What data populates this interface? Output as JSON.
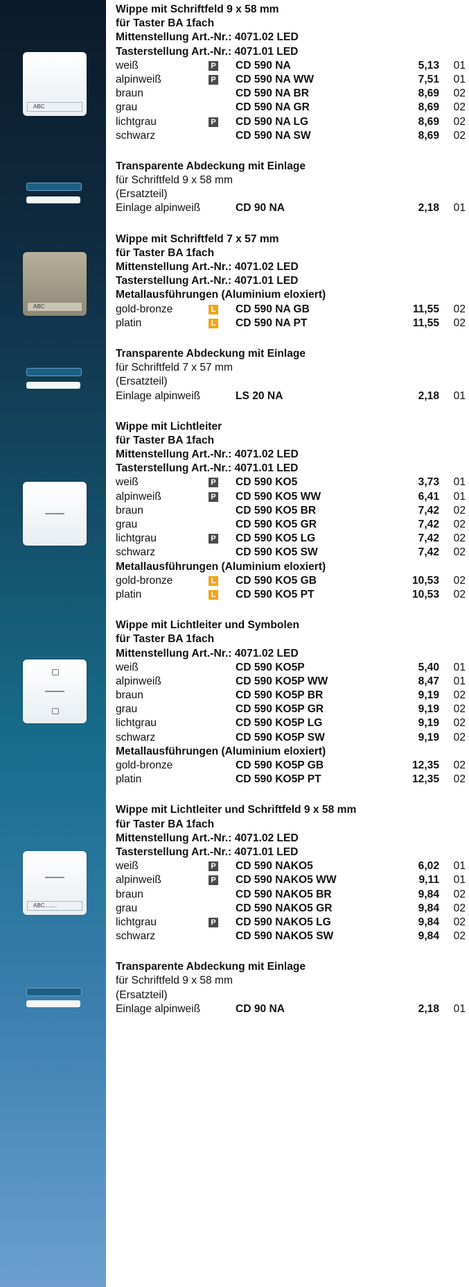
{
  "sections": [
    {
      "heading": [
        "Wippe mit Schriftfeld 9 x 58 mm",
        "für Taster BA 1fach",
        "Mittenstellung Art.-Nr.: 4071.02 LED",
        "Tasterstellung Art.-Nr.: 4071.01 LED"
      ],
      "rows": [
        {
          "color": "weiß",
          "badge": "P",
          "code": "CD 590 NA",
          "price": "5,13",
          "grp": "01"
        },
        {
          "color": "alpinweiß",
          "badge": "P",
          "code": "CD 590 NA WW",
          "price": "7,51",
          "grp": "01"
        },
        {
          "color": "braun",
          "badge": "",
          "code": "CD 590 NA BR",
          "price": "8,69",
          "grp": "02"
        },
        {
          "color": "grau",
          "badge": "",
          "code": "CD 590 NA GR",
          "price": "8,69",
          "grp": "02"
        },
        {
          "color": "lichtgrau",
          "badge": "P",
          "code": "CD 590 NA LG",
          "price": "8,69",
          "grp": "02"
        },
        {
          "color": "schwarz",
          "badge": "",
          "code": "CD 590 NA SW",
          "price": "8,69",
          "grp": "02"
        }
      ]
    },
    {
      "heading": [
        "Transparente Abdeckung mit Einlage"
      ],
      "text": [
        "für Schriftfeld 9 x 58 mm",
        "(Ersatzteil)"
      ],
      "rows": [
        {
          "color": "Einlage alpinweiß",
          "badge": "",
          "code": "CD 90 NA",
          "price": "2,18",
          "grp": "01"
        }
      ]
    },
    {
      "heading": [
        "Wippe mit Schriftfeld 7 x 57 mm",
        "für Taster BA 1fach",
        "Mittenstellung Art.-Nr.: 4071.02 LED",
        "Tasterstellung Art.-Nr.: 4071.01 LED",
        "Metallausführungen (Aluminium eloxiert)"
      ],
      "rows": [
        {
          "color": "gold-bronze",
          "badge": "L",
          "code": "CD 590 NA GB",
          "price": "11,55",
          "grp": "02"
        },
        {
          "color": "platin",
          "badge": "L",
          "code": "CD 590 NA PT",
          "price": "11,55",
          "grp": "02"
        }
      ]
    },
    {
      "heading": [
        "Transparente Abdeckung mit Einlage"
      ],
      "text": [
        "für Schriftfeld 7 x 57 mm",
        "(Ersatzteil)"
      ],
      "rows": [
        {
          "color": "Einlage alpinweiß",
          "badge": "",
          "code": "LS 20 NA",
          "price": "2,18",
          "grp": "01"
        }
      ]
    },
    {
      "heading": [
        "Wippe mit Lichtleiter",
        "für Taster BA 1fach",
        "Mittenstellung Art.-Nr.: 4071.02 LED",
        "Tasterstellung Art.-Nr.: 4071.01 LED"
      ],
      "rows": [
        {
          "color": "weiß",
          "badge": "P",
          "code": "CD 590 KO5",
          "price": "3,73",
          "grp": "01"
        },
        {
          "color": "alpinweiß",
          "badge": "P",
          "code": "CD 590 KO5 WW",
          "price": "6,41",
          "grp": "01"
        },
        {
          "color": "braun",
          "badge": "",
          "code": "CD 590 KO5 BR",
          "price": "7,42",
          "grp": "02"
        },
        {
          "color": "grau",
          "badge": "",
          "code": "CD 590 KO5 GR",
          "price": "7,42",
          "grp": "02"
        },
        {
          "color": "lichtgrau",
          "badge": "P",
          "code": "CD 590 KO5 LG",
          "price": "7,42",
          "grp": "02"
        },
        {
          "color": "schwarz",
          "badge": "",
          "code": "CD 590 KO5 SW",
          "price": "7,42",
          "grp": "02"
        }
      ],
      "subheading": "Metallausführungen (Aluminium eloxiert)",
      "rows2": [
        {
          "color": "gold-bronze",
          "badge": "L",
          "code": "CD 590 KO5 GB",
          "price": "10,53",
          "grp": "02"
        },
        {
          "color": "platin",
          "badge": "L",
          "code": "CD 590 KO5 PT",
          "price": "10,53",
          "grp": "02"
        }
      ]
    },
    {
      "heading": [
        "Wippe mit Lichtleiter und Symbolen",
        "für Taster BA 1fach",
        "Mittenstellung Art.-Nr.: 4071.02 LED"
      ],
      "rows": [
        {
          "color": "weiß",
          "badge": "",
          "code": "CD 590 KO5P",
          "price": "5,40",
          "grp": "01"
        },
        {
          "color": "alpinweiß",
          "badge": "",
          "code": "CD 590 KO5P WW",
          "price": "8,47",
          "grp": "01"
        },
        {
          "color": "braun",
          "badge": "",
          "code": "CD 590 KO5P BR",
          "price": "9,19",
          "grp": "02"
        },
        {
          "color": "grau",
          "badge": "",
          "code": "CD 590 KO5P GR",
          "price": "9,19",
          "grp": "02"
        },
        {
          "color": "lichtgrau",
          "badge": "",
          "code": "CD 590 KO5P LG",
          "price": "9,19",
          "grp": "02"
        },
        {
          "color": "schwarz",
          "badge": "",
          "code": "CD 590 KO5P SW",
          "price": "9,19",
          "grp": "02"
        }
      ],
      "subheading": "Metallausführungen (Aluminium eloxiert)",
      "rows2": [
        {
          "color": "gold-bronze",
          "badge": "",
          "code": "CD 590 KO5P GB",
          "price": "12,35",
          "grp": "02"
        },
        {
          "color": "platin",
          "badge": "",
          "code": "CD 590 KO5P PT",
          "price": "12,35",
          "grp": "02"
        }
      ]
    },
    {
      "heading": [
        "Wippe mit Lichtleiter und Schriftfeld 9 x 58 mm",
        "für Taster BA 1fach",
        "Mittenstellung Art.-Nr.: 4071.02 LED",
        "Tasterstellung Art.-Nr.: 4071.01 LED"
      ],
      "rows": [
        {
          "color": "weiß",
          "badge": "P",
          "code": "CD 590 NAKO5",
          "price": "6,02",
          "grp": "01"
        },
        {
          "color": "alpinweiß",
          "badge": "P",
          "code": "CD 590 NAKO5 WW",
          "price": "9,11",
          "grp": "01"
        },
        {
          "color": "braun",
          "badge": "",
          "code": "CD 590 NAKO5 BR",
          "price": "9,84",
          "grp": "02"
        },
        {
          "color": "grau",
          "badge": "",
          "code": "CD 590 NAKO5 GR",
          "price": "9,84",
          "grp": "02"
        },
        {
          "color": "lichtgrau",
          "badge": "P",
          "code": "CD 590 NAKO5 LG",
          "price": "9,84",
          "grp": "02"
        },
        {
          "color": "schwarz",
          "badge": "",
          "code": "CD 590 NAKO5 SW",
          "price": "9,84",
          "grp": "02"
        }
      ]
    },
    {
      "heading": [
        "Transparente Abdeckung mit Einlage"
      ],
      "text": [
        "für Schriftfeld 9 x 58 mm",
        "(Ersatzteil)"
      ],
      "rows": [
        {
          "color": "Einlage alpinweiß",
          "badge": "",
          "code": "CD 90 NA",
          "price": "2,18",
          "grp": "01"
        }
      ]
    }
  ],
  "image_labels": {
    "strip_1": "ABC",
    "strip_2": "ABC",
    "strip_3": "ABC........"
  }
}
